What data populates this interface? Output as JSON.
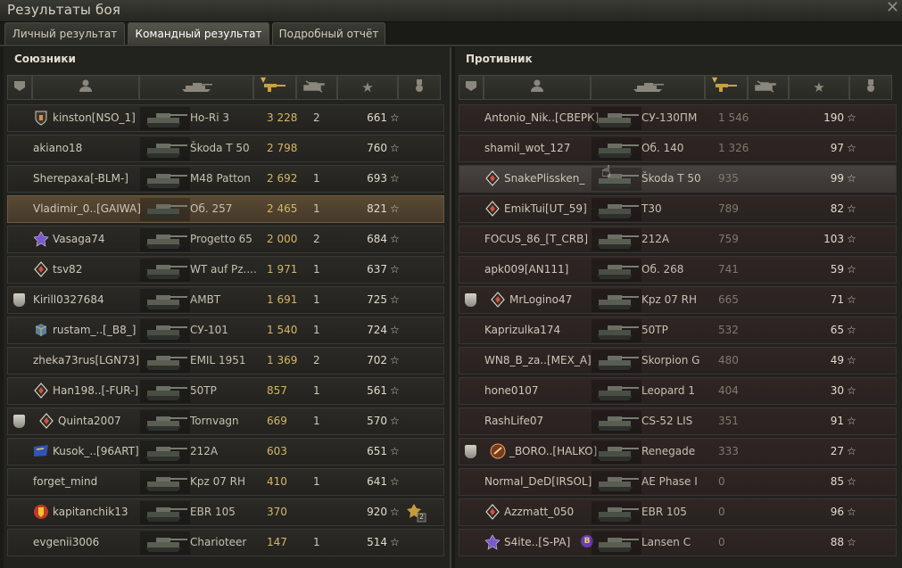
{
  "window": {
    "title": "Результаты боя",
    "close_icon": "close-icon"
  },
  "tabs": [
    {
      "label": "Личный результат",
      "active": false
    },
    {
      "label": "Командный результат",
      "active": true
    },
    {
      "label": "Подробный отчёт",
      "active": false
    }
  ],
  "columns": {
    "icons": [
      "squad-icon",
      "player-icon",
      "tank-icon",
      "damage-icon",
      "frags-icon",
      "xp-star-icon",
      "medal-icon"
    ],
    "sorted_column": "damage"
  },
  "allies": {
    "title": "Союзники",
    "players": [
      {
        "name": "kinston[NSO_1]",
        "tank": "Ho-Ri 3",
        "damage": "3 228",
        "frags": "2",
        "xp": "661",
        "badge": "shield-badge",
        "highlight": false
      },
      {
        "name": "akiano18",
        "tank": "Škoda T 50",
        "damage": "2 798",
        "frags": "",
        "xp": "760",
        "badge": "",
        "highlight": false
      },
      {
        "name": "Sherepaxa[-BLM-]",
        "tank": "M48 Patton",
        "damage": "2 692",
        "frags": "1",
        "xp": "693",
        "badge": "",
        "highlight": false
      },
      {
        "name": "Vladimir_0..[GAIWA]",
        "tank": "Об. 257",
        "damage": "2 465",
        "frags": "1",
        "xp": "821",
        "badge": "",
        "highlight": true
      },
      {
        "name": "Vasaga74",
        "tank": "Progetto 65",
        "damage": "2 000",
        "frags": "2",
        "xp": "684",
        "badge": "purple-badge",
        "highlight": false
      },
      {
        "name": "tsv82",
        "tank": "WT auf Pz....",
        "damage": "1 971",
        "frags": "1",
        "xp": "637",
        "badge": "diamond-badge",
        "highlight": false
      },
      {
        "name": "Kirill0327684",
        "tank": "AMBT",
        "damage": "1 691",
        "frags": "1",
        "xp": "725",
        "badge": "",
        "squad": "",
        "highlight": false
      },
      {
        "name": "rustam_..[_B8_]",
        "tank": "СУ-101",
        "damage": "1 540",
        "frags": "1",
        "xp": "724",
        "badge": "cube-badge",
        "highlight": false
      },
      {
        "name": "zheka73rus[LGN73]",
        "tank": "EMIL 1951",
        "damage": "1 369",
        "frags": "2",
        "xp": "702",
        "badge": "",
        "highlight": false
      },
      {
        "name": "Han198..[-FUR-]",
        "tank": "50TP",
        "damage": "857",
        "frags": "1",
        "xp": "561",
        "badge": "diamond-badge",
        "highlight": false
      },
      {
        "name": "Quinta2007",
        "tank": "Tornvagn",
        "damage": "669",
        "frags": "1",
        "xp": "570",
        "badge": "diamond-badge",
        "squad": "",
        "highlight": false
      },
      {
        "name": "Kusok_..[96ART]",
        "tank": "212A",
        "damage": "603",
        "frags": "",
        "xp": "651",
        "badge": "blue-flag-badge",
        "highlight": false
      },
      {
        "name": "forget_mind",
        "tank": "Kpz 07 RH",
        "damage": "410",
        "frags": "1",
        "xp": "641",
        "badge": "",
        "highlight": false
      },
      {
        "name": "kapitanchik13",
        "tank": "EBR 105",
        "damage": "370",
        "frags": "",
        "xp": "920",
        "badge": "orange-shield-badge",
        "highlight": false,
        "medal": "2"
      },
      {
        "name": "evgenii3006",
        "tank": "Charioteer",
        "damage": "147",
        "frags": "1",
        "xp": "514",
        "badge": "",
        "highlight": false
      }
    ]
  },
  "enemies": {
    "title": "Противник",
    "players": [
      {
        "name": "Antonio_Nik..[СВЕРК]",
        "tank": "СУ-130ПМ",
        "damage": "1 546",
        "xp": "190",
        "badge": ""
      },
      {
        "name": "shamil_wot_127",
        "tank": "Об. 140",
        "damage": "1 326",
        "xp": "97",
        "badge": ""
      },
      {
        "name": "SnakePlissken_",
        "tank": "Škoda T 50",
        "damage": "935",
        "xp": "99",
        "badge": "diamond-badge",
        "hover": true
      },
      {
        "name": "EmikTui[UT_59]",
        "tank": "T30",
        "damage": "789",
        "xp": "82",
        "badge": "diamond-badge"
      },
      {
        "name": "FOCUS_86_[T_CRB]",
        "tank": "212A",
        "damage": "759",
        "xp": "103",
        "badge": ""
      },
      {
        "name": "apk009[AN111]",
        "tank": "Об. 268",
        "damage": "741",
        "xp": "59",
        "badge": ""
      },
      {
        "name": "MrLogino47",
        "tank": "Kpz 07 RH",
        "damage": "665",
        "xp": "71",
        "badge": "diamond-badge",
        "squad": ""
      },
      {
        "name": "Kaprizulka174",
        "tank": "50TP",
        "damage": "532",
        "xp": "65",
        "badge": ""
      },
      {
        "name": "WN8_B_za..[MEX_A]",
        "tank": "Skorpion G",
        "damage": "480",
        "xp": "49",
        "badge": ""
      },
      {
        "name": "hone0107",
        "tank": "Leopard 1",
        "damage": "404",
        "xp": "30",
        "badge": ""
      },
      {
        "name": "RashLife07",
        "tank": "CS-52 LIS",
        "damage": "351",
        "xp": "91",
        "badge": ""
      },
      {
        "name": "_BORO..[HALKO]",
        "tank": "Renegade",
        "damage": "333",
        "xp": "27",
        "badge": "orange-badge",
        "squad": ""
      },
      {
        "name": "Normal_DeD[IRSOL]",
        "tank": "AE Phase I",
        "damage": "0",
        "xp": "85",
        "badge": ""
      },
      {
        "name": "Azzmatt_050",
        "tank": "EBR 105",
        "damage": "0",
        "xp": "96",
        "badge": "diamond-badge"
      },
      {
        "name": "S4ite..[S-PA]",
        "tank": "Lansen C",
        "damage": "0",
        "xp": "88",
        "badge": "purple-badge",
        "clan_letter": "B"
      }
    ]
  }
}
